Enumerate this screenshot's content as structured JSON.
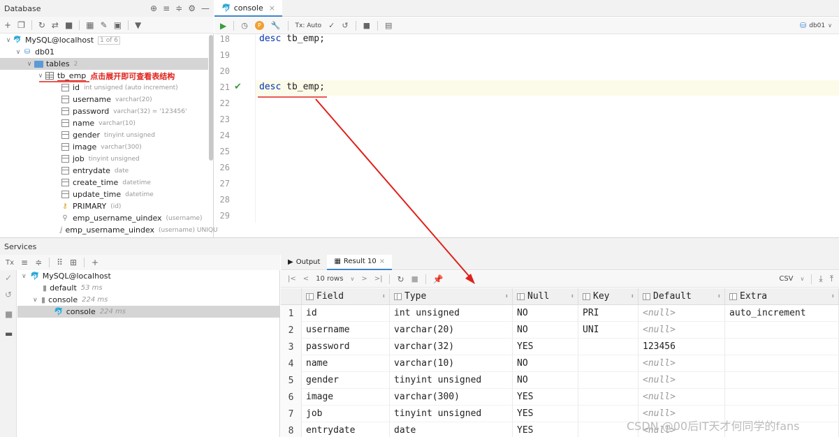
{
  "db_panel": {
    "title": "Database",
    "tree": {
      "connection": {
        "label": "MySQL@localhost",
        "hint": "1 of 6"
      },
      "database": {
        "label": "db01"
      },
      "tables_folder": {
        "label": "tables",
        "hint": "2"
      },
      "table": {
        "label": "tb_emp",
        "annotation": "点击展开即可查看表结构"
      },
      "columns": [
        {
          "name": "id",
          "type": "int unsigned (auto increment)"
        },
        {
          "name": "username",
          "type": "varchar(20)"
        },
        {
          "name": "password",
          "type": "varchar(32) = '123456'"
        },
        {
          "name": "name",
          "type": "varchar(10)"
        },
        {
          "name": "gender",
          "type": "tinyint unsigned"
        },
        {
          "name": "image",
          "type": "varchar(300)"
        },
        {
          "name": "job",
          "type": "tinyint unsigned"
        },
        {
          "name": "entrydate",
          "type": "date"
        },
        {
          "name": "create_time",
          "type": "datetime"
        },
        {
          "name": "update_time",
          "type": "datetime"
        }
      ],
      "keys": [
        {
          "name": "PRIMARY",
          "hint": "(id)"
        },
        {
          "name": "emp_username_uindex",
          "hint": "(username)"
        },
        {
          "name": "emp_username_uindex",
          "hint": "(username) UNIQU"
        }
      ]
    }
  },
  "editor": {
    "tab_label": "console",
    "toolbar": {
      "tx": "Tx: Auto",
      "schema": "db01"
    },
    "lines": [
      {
        "no": "18",
        "keyword": "desc",
        "rest": " tb_emp;"
      },
      {
        "no": "19",
        "keyword": "",
        "rest": ""
      },
      {
        "no": "20",
        "keyword": "",
        "rest": ""
      },
      {
        "no": "21",
        "keyword": "desc",
        "rest": " tb_emp;"
      },
      {
        "no": "22",
        "keyword": "",
        "rest": ""
      },
      {
        "no": "23",
        "keyword": "",
        "rest": ""
      },
      {
        "no": "24",
        "keyword": "",
        "rest": ""
      },
      {
        "no": "25",
        "keyword": "",
        "rest": ""
      },
      {
        "no": "26",
        "keyword": "",
        "rest": ""
      },
      {
        "no": "27",
        "keyword": "",
        "rest": ""
      },
      {
        "no": "28",
        "keyword": "",
        "rest": ""
      },
      {
        "no": "29",
        "keyword": "",
        "rest": ""
      }
    ]
  },
  "services": {
    "title": "Services",
    "tree": [
      {
        "label": "MySQL@localhost",
        "time": ""
      },
      {
        "label": "default",
        "time": "53 ms"
      },
      {
        "label": "console",
        "time": "224 ms"
      },
      {
        "label": "console",
        "time": "224 ms"
      }
    ]
  },
  "result": {
    "tabs": {
      "output": "Output",
      "result": "Result 10"
    },
    "toolbar": {
      "rows": "10 rows",
      "format": "CSV"
    },
    "headers": [
      "Field",
      "Type",
      "Null",
      "Key",
      "Default",
      "Extra"
    ],
    "rows": [
      {
        "n": "1",
        "cells": [
          "id",
          "int unsigned",
          "NO",
          "PRI",
          "<null>",
          "auto_increment"
        ]
      },
      {
        "n": "2",
        "cells": [
          "username",
          "varchar(20)",
          "NO",
          "UNI",
          "<null>",
          ""
        ]
      },
      {
        "n": "3",
        "cells": [
          "password",
          "varchar(32)",
          "YES",
          "",
          "123456",
          ""
        ]
      },
      {
        "n": "4",
        "cells": [
          "name",
          "varchar(10)",
          "NO",
          "",
          "<null>",
          ""
        ]
      },
      {
        "n": "5",
        "cells": [
          "gender",
          "tinyint unsigned",
          "NO",
          "",
          "<null>",
          ""
        ]
      },
      {
        "n": "6",
        "cells": [
          "image",
          "varchar(300)",
          "YES",
          "",
          "<null>",
          ""
        ]
      },
      {
        "n": "7",
        "cells": [
          "job",
          "tinyint unsigned",
          "YES",
          "",
          "<null>",
          ""
        ]
      },
      {
        "n": "8",
        "cells": [
          "entrydate",
          "date",
          "YES",
          "",
          "<null>",
          ""
        ]
      }
    ]
  },
  "watermark": "CSDN @00后IT天才何同学的fans",
  "colors": {
    "annotation": "#e0201a",
    "keyword": "#0033b3",
    "accent": "#4083c9"
  }
}
